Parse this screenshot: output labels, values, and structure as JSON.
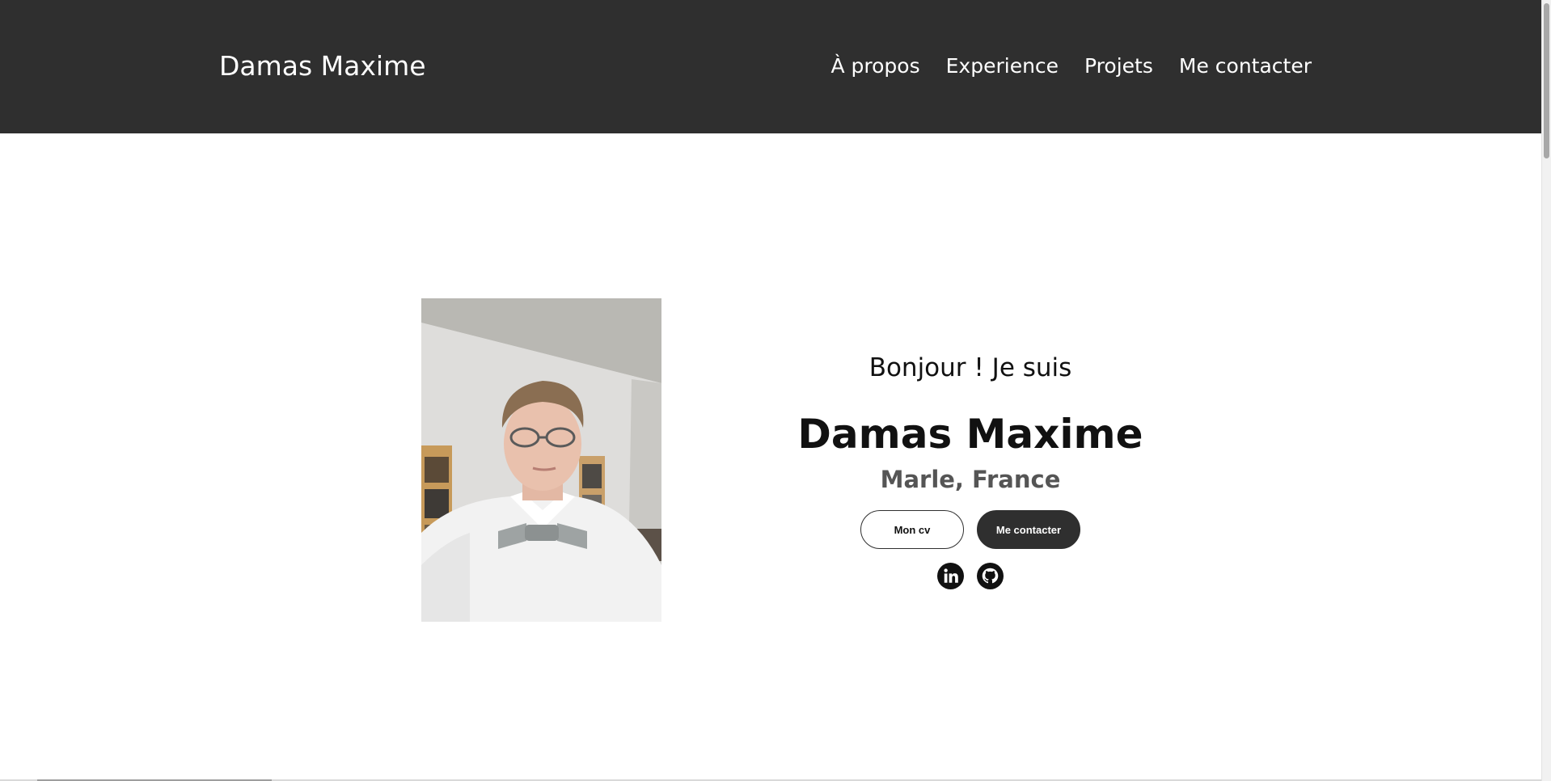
{
  "header": {
    "brand": "Damas Maxime",
    "nav": [
      {
        "label": "À propos"
      },
      {
        "label": "Experience"
      },
      {
        "label": "Projets"
      },
      {
        "label": "Me contacter"
      }
    ]
  },
  "hero": {
    "greeting": "Bonjour ! Je suis",
    "name": "Damas Maxime",
    "location": "Marle, France",
    "buttons": {
      "cv": "Mon cv",
      "contact": "Me contacter"
    },
    "socials": [
      {
        "icon": "linkedin-icon"
      },
      {
        "icon": "github-icon"
      }
    ]
  },
  "colors": {
    "header_bg": "#2f2f2f",
    "accent_dark": "#2f2f2f",
    "subtitle": "#555555"
  }
}
